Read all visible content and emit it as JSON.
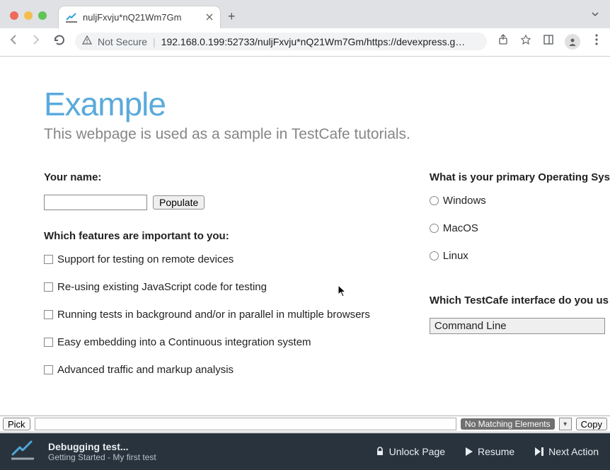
{
  "browser": {
    "tab_title": "nuljFxvju*nQ21Wm7Gm",
    "not_secure_label": "Not Secure",
    "url_display": "192.168.0.199:52733/nuljFxvju*nQ21Wm7Gm/https://devexpress.g…"
  },
  "page": {
    "title": "Example",
    "subtitle": "This webpage is used as a sample in TestCafe tutorials.",
    "name_label": "Your name:",
    "populate_button": "Populate",
    "features_label": "Which features are important to you:",
    "features": [
      "Support for testing on remote devices",
      "Re-using existing JavaScript code for testing",
      "Running tests in background and/or in parallel in multiple browsers",
      "Easy embedding into a Continuous integration system",
      "Advanced traffic and markup analysis"
    ],
    "os_label": "What is your primary Operating Sys",
    "os_options": [
      "Windows",
      "MacOS",
      "Linux"
    ],
    "interface_label": "Which TestCafe interface do you us",
    "interface_selected": "Command Line"
  },
  "pickbar": {
    "pick_label": "Pick",
    "no_match_label": "No Matching Elements",
    "copy_label": "Copy"
  },
  "debug": {
    "title": "Debugging test...",
    "subtitle": "Getting Started - My first test",
    "unlock_label": "Unlock Page",
    "resume_label": "Resume",
    "next_label": "Next Action"
  }
}
